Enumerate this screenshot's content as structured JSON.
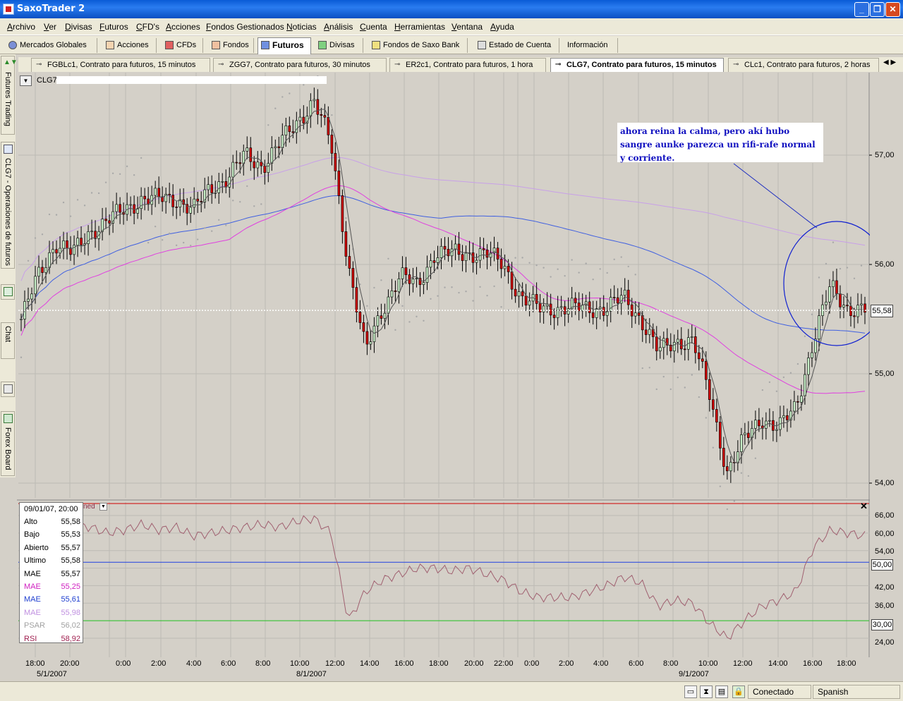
{
  "window": {
    "title": "SaxoTrader 2",
    "controls": [
      "_",
      "❐",
      "✕"
    ]
  },
  "menu": [
    "Archivo",
    "Ver",
    "Divisas",
    "Futuros",
    "CFD's",
    "Acciones",
    "Fondos Gestionados",
    "Noticias",
    "Análisis",
    "Cuenta",
    "Herramientas",
    "Ventana",
    "Ayuda"
  ],
  "toolbar": [
    {
      "label": "Mercados Globales",
      "icon": "globe-icon"
    },
    {
      "label": "Acciones",
      "icon": "stocks-icon"
    },
    {
      "label": "CFDs",
      "icon": "cfd-icon"
    },
    {
      "label": "Fondos",
      "icon": "funds-icon"
    },
    {
      "label": "Futuros",
      "icon": "futures-icon",
      "active": true
    },
    {
      "label": "Divisas",
      "icon": "fx-icon"
    },
    {
      "label": "Fondos de Saxo Bank",
      "icon": "saxo-funds-icon"
    },
    {
      "label": "Estado de Cuenta",
      "icon": "account-icon"
    },
    {
      "label": "Información",
      "icon": "info-icon"
    }
  ],
  "doc_tabs": [
    {
      "label": "FGBLc1, Contrato para futuros, 15 minutos"
    },
    {
      "label": "ZGG7, Contrato para futuros, 30 minutos"
    },
    {
      "label": "ER2c1, Contrato para futuros, 1 hora"
    },
    {
      "label": "CLG7, Contrato para futuros, 15 minutos",
      "active": true
    },
    {
      "label": "CLc1, Contrato para futuros, 2 horas"
    }
  ],
  "rail": [
    "Futures Trading",
    "CLG7 - Operaciones de futuros",
    "Chat",
    "Forex Board"
  ],
  "chart": {
    "symbol": "CLG7",
    "annotation": "ahora reina la calma, pero akí hubo sangre aunke parezca un rifi-rafe normal y corriente.",
    "current_price": "55,58",
    "price_ticks": [
      "57,00",
      "56,00",
      "55,00",
      "54,00"
    ],
    "rsi_label": "ned",
    "rsi_ticks": [
      "66,00",
      "60,00",
      "54,00",
      "48,00",
      "42,00",
      "36,00",
      "30,00",
      "24,00"
    ],
    "rsi_levels": [
      "50,00",
      "30,00"
    ],
    "close_symbol": "✕"
  },
  "chart_data": {
    "type": "candlestick",
    "symbol": "CLG7",
    "timeframe": "15 minutos",
    "ylim": [
      53.9,
      57.6
    ],
    "rsi_ylim": [
      20,
      70
    ],
    "close_approx": [
      55.5,
      55.9,
      56.2,
      56.1,
      56.3,
      56.4,
      56.5,
      56.6,
      56.6,
      56.6,
      56.5,
      56.7,
      56.8,
      57.0,
      56.9,
      57.1,
      57.3,
      57.5,
      57.1,
      56.0,
      55.2,
      55.6,
      55.9,
      55.8,
      56.1,
      56.1,
      56.1,
      56.1,
      56.0,
      55.7,
      55.6,
      55.6,
      55.6,
      55.6,
      55.6,
      55.7,
      55.5,
      55.2,
      55.3,
      55.3,
      54.8,
      54.1,
      54.4,
      54.6,
      54.5,
      54.7,
      55.3,
      55.8,
      55.6,
      55.58
    ],
    "rsi_approx": [
      60,
      63,
      64,
      63,
      62,
      60,
      61,
      63,
      61,
      62,
      59,
      60,
      61,
      62,
      63,
      62,
      64,
      65,
      60,
      30,
      40,
      44,
      46,
      48,
      48,
      47,
      48,
      46,
      44,
      40,
      38,
      38,
      38,
      40,
      42,
      45,
      43,
      35,
      37,
      36,
      29,
      24,
      30,
      35,
      37,
      40,
      55,
      61,
      60,
      59
    ],
    "indicators": [
      "MAE",
      "MAE",
      "MAE",
      "MAE",
      "PSAR",
      "RSI"
    ],
    "x_time_labels": [
      "18:00",
      "20:00",
      "0:00",
      "2:00",
      "4:00",
      "6:00",
      "8:00",
      "10:00",
      "12:00",
      "14:00",
      "16:00",
      "18:00",
      "20:00",
      "22:00",
      "0:00",
      "2:00",
      "4:00",
      "6:00",
      "8:00",
      "10:00",
      "12:00",
      "14:00",
      "16:00",
      "18:00"
    ],
    "x_date_labels": [
      "5/1/2007",
      "8/1/2007",
      "9/1/2007"
    ],
    "colors": {
      "up": "#c8f0c8",
      "down": "#d00000",
      "mae1": "#555555",
      "mae2": "#e040e0",
      "mae3": "#4060e0",
      "mae4": "#c8a0e8",
      "psar": "#a8a8a8",
      "rsi": "#a06070",
      "bg": "#d4d0c8"
    }
  },
  "data_window": {
    "datetime": "09/01/07, 20:00",
    "rows": [
      {
        "k": "Alto",
        "v": "55,58",
        "color": "#000000"
      },
      {
        "k": "Bajo",
        "v": "55,53",
        "color": "#000000"
      },
      {
        "k": "Abierto",
        "v": "55,57",
        "color": "#000000"
      },
      {
        "k": "Ultimo",
        "v": "55,58",
        "color": "#000000"
      },
      {
        "k": "MAE",
        "v": "55,57",
        "color": "#000000"
      },
      {
        "k": "MAE",
        "v": "55,25",
        "color": "#d020c0"
      },
      {
        "k": "MAE",
        "v": "55,61",
        "color": "#2040d0"
      },
      {
        "k": "MAE",
        "v": "55,98",
        "color": "#c090e0"
      },
      {
        "k": "PSAR",
        "v": "56,02",
        "color": "#a0a0a0"
      },
      {
        "k": "RSI",
        "v": "58,92",
        "color": "#a02050"
      }
    ]
  },
  "statusbar": {
    "connection": "Conectado",
    "language": "Spanish"
  }
}
